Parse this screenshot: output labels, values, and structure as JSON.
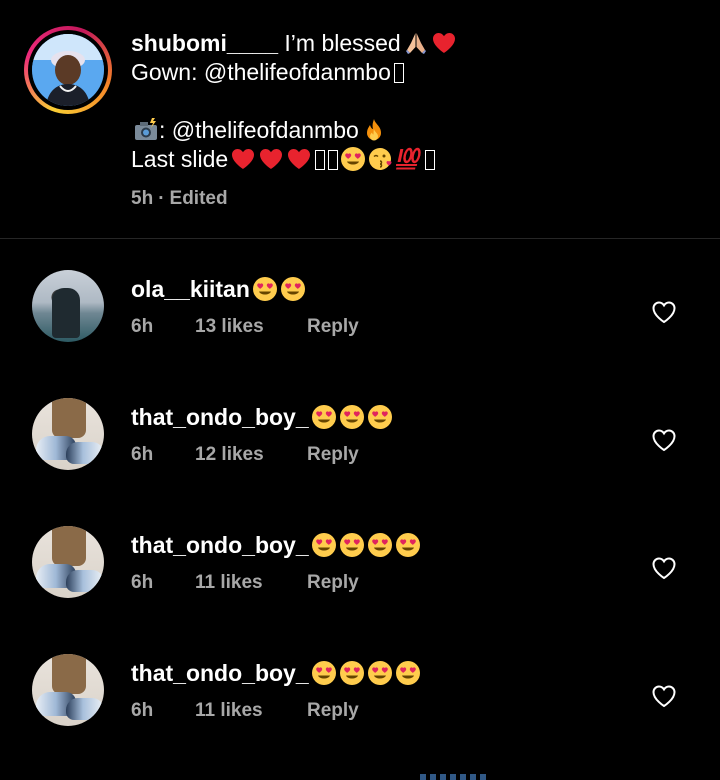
{
  "caption": {
    "username": "shubomi____",
    "line1_text": " I’m blessed",
    "line1_emojis": [
      "folded-hands",
      "red-heart"
    ],
    "line2_text": "Gown: @thelifeofdanmbo",
    "line3_text": ": @thelifeofdanmbo",
    "line3_emoji_prefix": "camera-flash",
    "line3_emoji_suffix": "fire",
    "line4_text": "Last slide",
    "line4_emojis": [
      "red-heart",
      "red-heart",
      "red-heart",
      "missing-glyph",
      "missing-glyph",
      "heart-eyes",
      "face-blowing-kiss",
      "hundred-points",
      "missing-glyph"
    ],
    "time": "5h",
    "separator": "·",
    "edited": "Edited"
  },
  "comments": [
    {
      "username": "ola__kiitan",
      "emojis": [
        "heart-eyes",
        "heart-eyes"
      ],
      "time": "6h",
      "likes": "13 likes",
      "reply": "Reply"
    },
    {
      "username": "that_ondo_boy_",
      "emojis": [
        "heart-eyes",
        "heart-eyes",
        "heart-eyes"
      ],
      "time": "6h",
      "likes": "12 likes",
      "reply": "Reply"
    },
    {
      "username": "that_ondo_boy_",
      "emojis": [
        "heart-eyes",
        "heart-eyes",
        "heart-eyes",
        "heart-eyes"
      ],
      "time": "6h",
      "likes": "11 likes",
      "reply": "Reply"
    },
    {
      "username": "that_ondo_boy_",
      "emojis": [
        "heart-eyes",
        "heart-eyes",
        "heart-eyes",
        "heart-eyes"
      ],
      "time": "6h",
      "likes": "11 likes",
      "reply": "Reply"
    }
  ],
  "colors": {
    "background": "#000000",
    "text": "#ffffff",
    "secondary_text": "#a8a8a8",
    "divider": "#262626"
  }
}
